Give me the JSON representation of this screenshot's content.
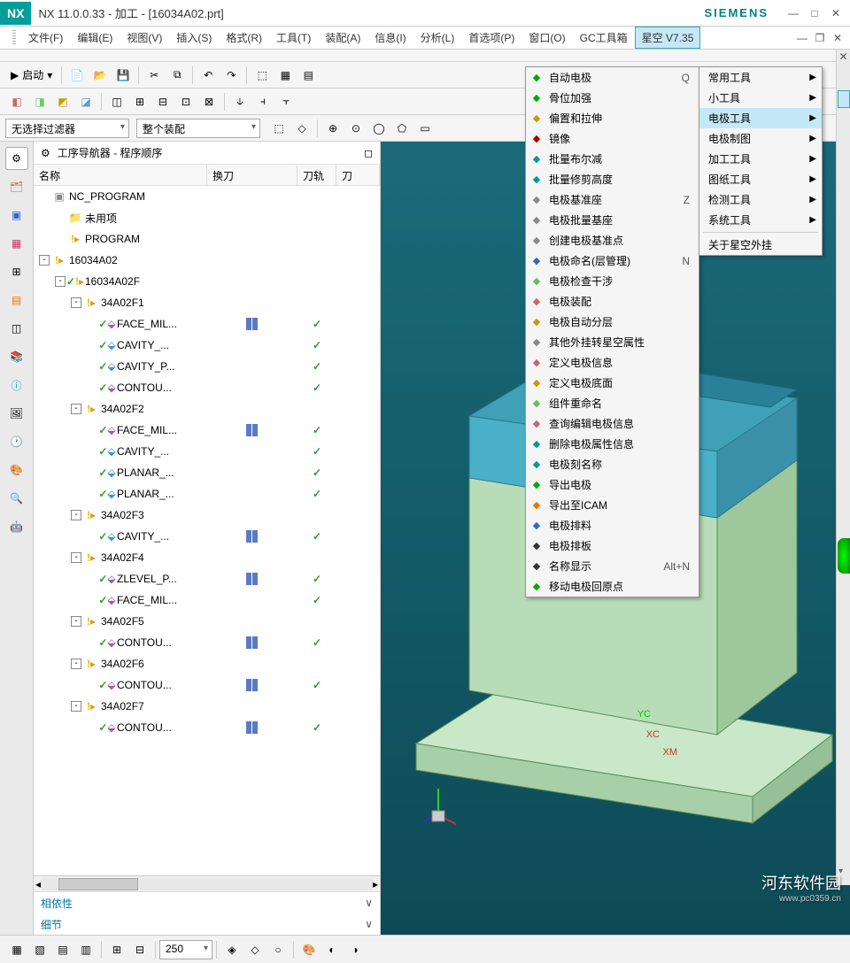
{
  "titlebar": {
    "logo": "NX",
    "title": "NX 11.0.0.33 - 加工 - [16034A02.prt]",
    "brand": "SIEMENS"
  },
  "menubar": {
    "items": [
      "文件(F)",
      "编辑(E)",
      "视图(V)",
      "插入(S)",
      "格式(R)",
      "工具(T)",
      "装配(A)",
      "信息(I)",
      "分析(L)",
      "首选项(P)",
      "窗口(O)",
      "GC工具箱",
      "星空 V7.35"
    ]
  },
  "toolbar": {
    "start": "启动",
    "filter1": "无选择过滤器",
    "filter2": "整个装配"
  },
  "navigator": {
    "title": "工序导航器 - 程序顺序",
    "columns": {
      "name": "名称",
      "tool": "换刀",
      "path": "刀轨",
      "extra": "刀"
    },
    "tree": [
      {
        "level": 0,
        "expand": "",
        "icon": "nc",
        "label": "NC_PROGRAM",
        "tool": "",
        "path": ""
      },
      {
        "level": 1,
        "expand": "",
        "icon": "folder",
        "label": "未用项",
        "tool": "",
        "path": ""
      },
      {
        "level": 1,
        "expand": "",
        "icon": "exclaim-folder",
        "label": "PROGRAM",
        "tool": "",
        "path": ""
      },
      {
        "level": 0,
        "expand": "-",
        "icon": "exclaim-folder",
        "label": "16034A02",
        "tool": "",
        "path": ""
      },
      {
        "level": 1,
        "expand": "-",
        "icon": "check-exclaim-folder",
        "label": "16034A02F",
        "tool": "",
        "path": ""
      },
      {
        "level": 2,
        "expand": "-",
        "icon": "exclaim-folder",
        "label": "34A02F1",
        "tool": "",
        "path": ""
      },
      {
        "level": 3,
        "expand": "",
        "icon": "check-op-purple",
        "label": "FACE_MIL...",
        "tool": "tick",
        "path": "check"
      },
      {
        "level": 3,
        "expand": "",
        "icon": "check-op-blue",
        "label": "CAVITY_...",
        "tool": "",
        "path": "check"
      },
      {
        "level": 3,
        "expand": "",
        "icon": "check-op-blue",
        "label": "CAVITY_P...",
        "tool": "",
        "path": "check"
      },
      {
        "level": 3,
        "expand": "",
        "icon": "check-op-purple",
        "label": "CONTOU...",
        "tool": "",
        "path": "check"
      },
      {
        "level": 2,
        "expand": "-",
        "icon": "exclaim-folder",
        "label": "34A02F2",
        "tool": "",
        "path": ""
      },
      {
        "level": 3,
        "expand": "",
        "icon": "check-op-purple",
        "label": "FACE_MIL...",
        "tool": "tick",
        "path": "check"
      },
      {
        "level": 3,
        "expand": "",
        "icon": "check-op-blue",
        "label": "CAVITY_...",
        "tool": "",
        "path": "check"
      },
      {
        "level": 3,
        "expand": "",
        "icon": "check-op-blue",
        "label": "PLANAR_...",
        "tool": "",
        "path": "check"
      },
      {
        "level": 3,
        "expand": "",
        "icon": "check-op-blue",
        "label": "PLANAR_...",
        "tool": "",
        "path": "check"
      },
      {
        "level": 2,
        "expand": "-",
        "icon": "exclaim-folder",
        "label": "34A02F3",
        "tool": "",
        "path": ""
      },
      {
        "level": 3,
        "expand": "",
        "icon": "check-op-blue",
        "label": "CAVITY_...",
        "tool": "tick",
        "path": "check"
      },
      {
        "level": 2,
        "expand": "-",
        "icon": "exclaim-folder",
        "label": "34A02F4",
        "tool": "",
        "path": ""
      },
      {
        "level": 3,
        "expand": "",
        "icon": "check-op-purple",
        "label": "ZLEVEL_P...",
        "tool": "tick",
        "path": "check"
      },
      {
        "level": 3,
        "expand": "",
        "icon": "check-op-purple",
        "label": "FACE_MIL...",
        "tool": "",
        "path": "check"
      },
      {
        "level": 2,
        "expand": "-",
        "icon": "exclaim-folder",
        "label": "34A02F5",
        "tool": "",
        "path": ""
      },
      {
        "level": 3,
        "expand": "",
        "icon": "check-op-purple",
        "label": "CONTOU...",
        "tool": "tick",
        "path": "check"
      },
      {
        "level": 2,
        "expand": "-",
        "icon": "exclaim-folder",
        "label": "34A02F6",
        "tool": "",
        "path": ""
      },
      {
        "level": 3,
        "expand": "",
        "icon": "check-op-purple",
        "label": "CONTOU...",
        "tool": "tick",
        "path": "check"
      },
      {
        "level": 2,
        "expand": "-",
        "icon": "exclaim-folder",
        "label": "34A02F7",
        "tool": "",
        "path": ""
      },
      {
        "level": 3,
        "expand": "",
        "icon": "check-op-purple",
        "label": "CONTOU...",
        "tool": "tick",
        "path": "check"
      }
    ],
    "accordion": {
      "dep": "相依性",
      "detail": "细节"
    }
  },
  "submenu1": {
    "items": [
      "常用工具",
      "小工具",
      "电极工具",
      "电极制图",
      "加工工具",
      "图纸工具",
      "检测工具",
      "系统工具"
    ],
    "about": "关于星空外挂"
  },
  "submenu2": [
    {
      "icon": "#0a0",
      "label": "自动电极",
      "shortcut": "Q"
    },
    {
      "icon": "#0a0",
      "label": "骨位加强",
      "shortcut": ""
    },
    {
      "icon": "#c90",
      "label": "偏置和拉伸",
      "shortcut": ""
    },
    {
      "icon": "#a00",
      "label": "镜像",
      "shortcut": ""
    },
    {
      "icon": "#099",
      "label": "批量布尔减",
      "shortcut": ""
    },
    {
      "icon": "#099",
      "label": "批量修剪高度",
      "shortcut": ""
    },
    {
      "icon": "#888",
      "label": "电极基准座",
      "shortcut": "Z"
    },
    {
      "icon": "#888",
      "label": "电极批量基座",
      "shortcut": ""
    },
    {
      "icon": "#888",
      "label": "创建电极基准点",
      "shortcut": ""
    },
    {
      "icon": "#36c",
      "label": "电极命名(层管理)",
      "shortcut": "N"
    },
    {
      "icon": "#6b6",
      "label": "电极检查干涉",
      "shortcut": ""
    },
    {
      "icon": "#c66",
      "label": "电极装配",
      "shortcut": ""
    },
    {
      "icon": "#c90",
      "label": "电极自动分层",
      "shortcut": ""
    },
    {
      "icon": "#888",
      "label": "其他外挂转星空属性",
      "shortcut": ""
    },
    {
      "icon": "#c66",
      "label": "定义电极信息",
      "shortcut": ""
    },
    {
      "icon": "#c90",
      "label": "定义电极底面",
      "shortcut": ""
    },
    {
      "icon": "#6b6",
      "label": "组件重命名",
      "shortcut": ""
    },
    {
      "icon": "#c66",
      "label": "查询编辑电极信息",
      "shortcut": ""
    },
    {
      "icon": "#099",
      "label": "删除电极属性信息",
      "shortcut": ""
    },
    {
      "icon": "#099",
      "label": "电极刻名称",
      "shortcut": ""
    },
    {
      "icon": "#0a0",
      "label": "导出电极",
      "shortcut": ""
    },
    {
      "icon": "#e70",
      "label": "导出至ICAM",
      "shortcut": ""
    },
    {
      "icon": "#36c",
      "label": "电极排料",
      "shortcut": ""
    },
    {
      "icon": "#333",
      "label": "电极排板",
      "shortcut": ""
    },
    {
      "icon": "#333",
      "label": "名称显示",
      "shortcut": "Alt+N"
    },
    {
      "icon": "#0a0",
      "label": "移动电极回原点",
      "shortcut": ""
    }
  ],
  "bottom": {
    "combo": "250"
  },
  "viewport": {
    "axis1": "YC",
    "axis2": "XC",
    "axis3": "XM"
  },
  "watermark": {
    "main": "河东软件园",
    "url": "www.pc0359.cn"
  }
}
